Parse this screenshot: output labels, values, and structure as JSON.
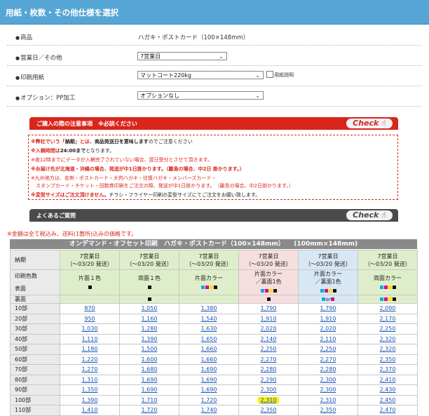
{
  "page": {
    "title": "用紙・枚数・その他仕様を選択"
  },
  "form": {
    "product_label": "商品",
    "product_value": "ハガキ・ポストカード（100×148mm）",
    "business_days_label": "営業日／その他",
    "business_days_value": "7営業日",
    "paper_label": "印刷用紙",
    "paper_value": "マットコート220kg",
    "paper_desc_label": "用紙説明",
    "option_label": "オプション：PP加工",
    "option_value": "オプションなし"
  },
  "notice": {
    "header": "ご購入の際の注意事項　※必読ください",
    "check_label": "Check",
    "lines": [
      {
        "pre": "※弊社でいう「",
        "bold": "納期",
        "mid": "」とは、",
        "bold2": "商品発送日を意味します",
        "post": "のでご注意ください"
      },
      {
        "pre": "※入稿時間は",
        "bold": "24:00まで",
        "post": "となります。"
      },
      {
        "pre": "※夜12時までにデータが入稿完了されていない場合、翌日受付とさせて頂きます。"
      },
      {
        "pre": "※お届け先が北海道・沖縄の場合、発送が中1日掛かります。（離島の場合、中2日 掛かります。）"
      },
      {
        "pre": "※九州地方は、名刺・ポストカード・大判ハガキ・往復ハガキ・メンバーズカード・"
      },
      {
        "pre": "　スタンプカード・チケット・回数券印刷をご注文の際、発送が中1日掛かります。　（離島の場合、中2日掛かります。）"
      },
      {
        "pre": "※",
        "bold": "変型サイズはご注文頂けません。",
        "post": "チラシ・フライヤー印刷の変型サイズにてご注文をお願い致します。"
      }
    ]
  },
  "faq": {
    "header": "よくあるご質問",
    "check_label": "Check"
  },
  "tax_note": "※金額は全て税込み、送料(1箇所)込みの価格です。",
  "price_table": {
    "title": "オンデマンド・オフセット印刷　ハガキ・ポストカード（100×148mm）　　(100mm×148mm)",
    "delivery_label": "納期",
    "print_colors_label": "印刷色数",
    "front_label": "表面",
    "back_label": "裏面",
    "columns": [
      {
        "days": "7営業日",
        "ship": "（〜03/20 発送）",
        "colors": "片面１色"
      },
      {
        "days": "7営業日",
        "ship": "（〜03/20 発送）",
        "colors": "両面１色"
      },
      {
        "days": "7営業日",
        "ship": "（〜03/20 発送）",
        "colors": "片面カラー"
      },
      {
        "days": "7営業日",
        "ship": "（〜03/20 発送）",
        "colors": "片面カラー\n／裏面1色"
      },
      {
        "days": "7営業日",
        "ship": "（〜03/20 発送）",
        "colors": "片面カラー\n／裏面1色"
      },
      {
        "days": "7営業日",
        "ship": "（〜03/20 発送）",
        "colors": "両面カラー"
      }
    ],
    "or_label": "or",
    "rows": [
      {
        "qty": "10部",
        "prices": [
          "870",
          "1,050",
          "1,380",
          "1,790",
          "1,790",
          "2,090"
        ]
      },
      {
        "qty": "20部",
        "prices": [
          "950",
          "1,160",
          "1,540",
          "1,910",
          "1,910",
          "2,170"
        ]
      },
      {
        "qty": "30部",
        "prices": [
          "1,030",
          "1,280",
          "1,630",
          "2,020",
          "2,020",
          "2,250"
        ]
      },
      {
        "qty": "40部",
        "prices": [
          "1,110",
          "1,390",
          "1,650",
          "2,140",
          "2,110",
          "2,320"
        ]
      },
      {
        "qty": "50部",
        "prices": [
          "1,180",
          "1,500",
          "1,660",
          "2,250",
          "2,250",
          "2,320"
        ]
      },
      {
        "qty": "60部",
        "prices": [
          "1,220",
          "1,600",
          "1,660",
          "2,270",
          "2,270",
          "2,350"
        ]
      },
      {
        "qty": "70部",
        "prices": [
          "1,270",
          "1,680",
          "1,690",
          "2,280",
          "2,280",
          "2,370"
        ]
      },
      {
        "qty": "80部",
        "prices": [
          "1,310",
          "1,690",
          "1,690",
          "2,290",
          "2,300",
          "2,410"
        ]
      },
      {
        "qty": "90部",
        "prices": [
          "1,350",
          "1,690",
          "1,690",
          "2,300",
          "2,300",
          "2,430"
        ]
      },
      {
        "qty": "100部",
        "prices": [
          "1,390",
          "1,710",
          "1,720",
          "2,310",
          "2,310",
          "2,450"
        ]
      },
      {
        "qty": "110部",
        "prices": [
          "1,410",
          "1,720",
          "1,740",
          "2,350",
          "2,350",
          "2,470"
        ]
      }
    ],
    "highlighted": {
      "row": 9,
      "col": 3
    }
  },
  "colors": {
    "header_blue": "#55a6d4",
    "notice_red": "#d9261c",
    "faq_dark": "#4a4a4a",
    "highlight_yellow": "#fff000",
    "cyan": "#00aee8",
    "magenta": "#e4007f",
    "yellow": "#ffe100",
    "black": "#111111"
  }
}
